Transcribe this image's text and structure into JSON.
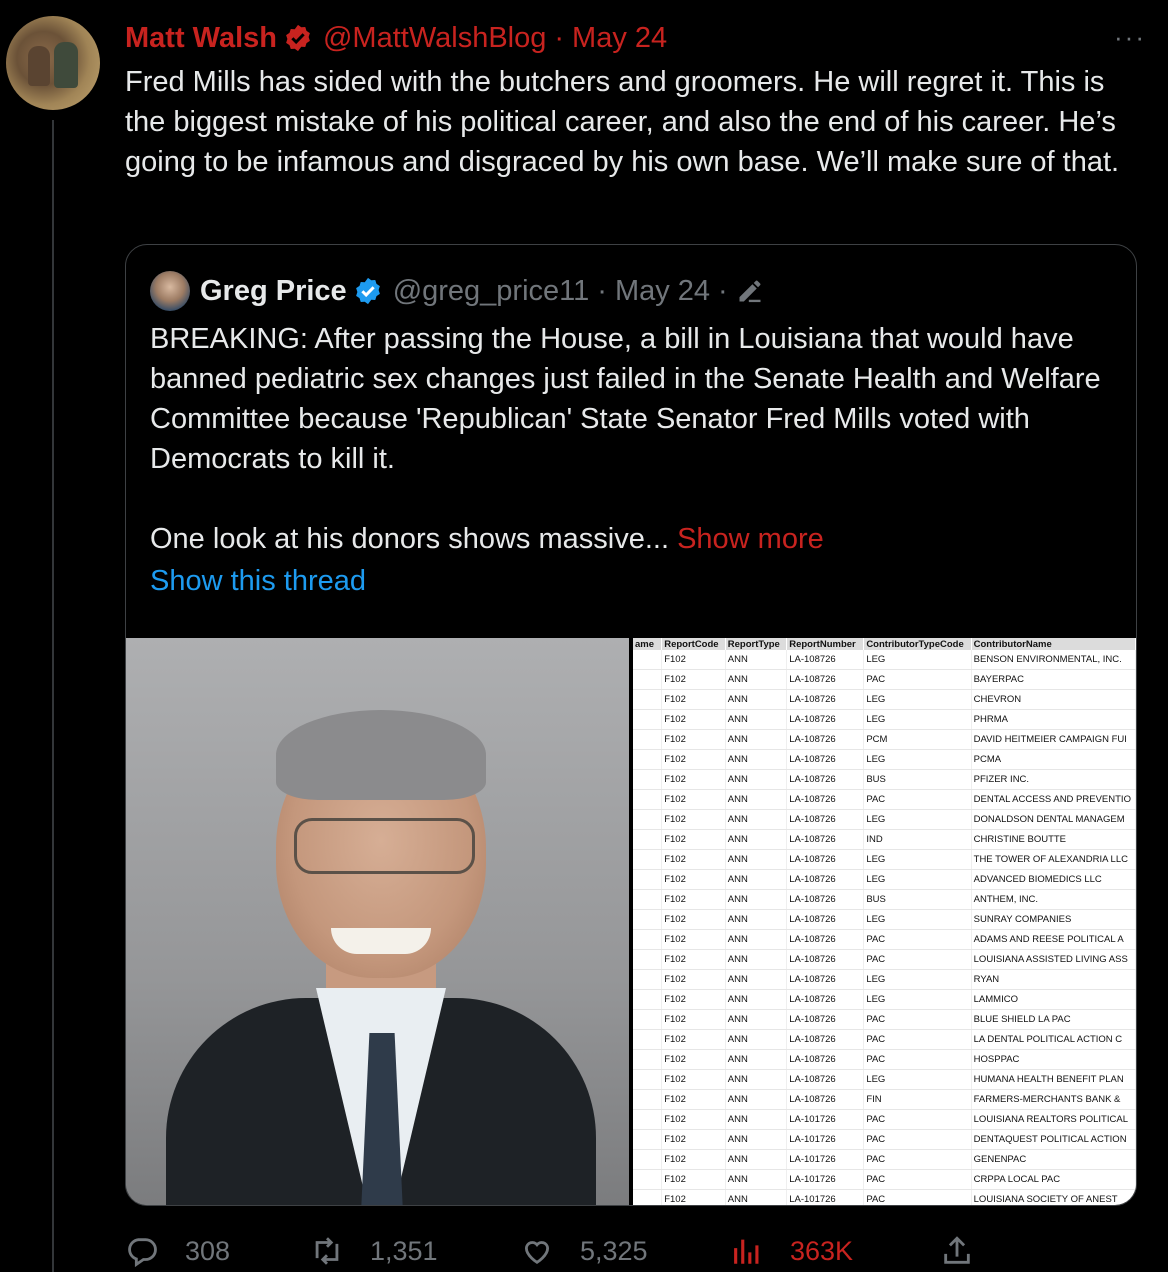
{
  "tweet": {
    "author_name": "Matt Walsh",
    "author_handle": "@MattWalshBlog",
    "date": "May 24",
    "text": "Fred Mills has sided with the butchers and groomers. He will regret it. This is the biggest mistake of his political career, and also the end of his career. He’s going to be infamous and disgraced by his own base. We’ll make sure of that.",
    "more_label": "···"
  },
  "quote": {
    "author_name": "Greg Price",
    "author_handle": "@greg_price11",
    "date": "May 24",
    "text_main": "BREAKING: After passing the House, a bill in Louisiana that would have banned pediatric sex changes just failed in the Senate Health and Welfare Committee because 'Republican' State Senator Fred Mills voted with Democrats to kill it.\n\nOne look at his donors shows massive... ",
    "show_more": "Show more",
    "show_thread": "Show this thread"
  },
  "sheet": {
    "headers": [
      "ame",
      "ReportCode",
      "ReportType",
      "ReportNumber",
      "ContributorTypeCode",
      "ContributorName"
    ],
    "rows": [
      [
        "",
        "F102",
        "ANN",
        "LA-108726",
        "LEG",
        "BENSON ENVIRONMENTAL, INC."
      ],
      [
        "",
        "F102",
        "ANN",
        "LA-108726",
        "PAC",
        "BAYERPAC"
      ],
      [
        "",
        "F102",
        "ANN",
        "LA-108726",
        "LEG",
        "CHEVRON"
      ],
      [
        "",
        "F102",
        "ANN",
        "LA-108726",
        "LEG",
        "PHRMA"
      ],
      [
        "",
        "F102",
        "ANN",
        "LA-108726",
        "PCM",
        "DAVID HEITMEIER CAMPAIGN FUI"
      ],
      [
        "",
        "F102",
        "ANN",
        "LA-108726",
        "LEG",
        "PCMA"
      ],
      [
        "",
        "F102",
        "ANN",
        "LA-108726",
        "BUS",
        "PFIZER INC."
      ],
      [
        "",
        "F102",
        "ANN",
        "LA-108726",
        "PAC",
        "DENTAL ACCESS AND PREVENTIO"
      ],
      [
        "",
        "F102",
        "ANN",
        "LA-108726",
        "LEG",
        "DONALDSON DENTAL MANAGEM"
      ],
      [
        "",
        "F102",
        "ANN",
        "LA-108726",
        "IND",
        "CHRISTINE BOUTTE"
      ],
      [
        "",
        "F102",
        "ANN",
        "LA-108726",
        "LEG",
        "THE TOWER OF ALEXANDRIA LLC"
      ],
      [
        "",
        "F102",
        "ANN",
        "LA-108726",
        "LEG",
        "ADVANCED BIOMEDICS LLC"
      ],
      [
        "",
        "F102",
        "ANN",
        "LA-108726",
        "BUS",
        "ANTHEM, INC."
      ],
      [
        "",
        "F102",
        "ANN",
        "LA-108726",
        "LEG",
        "SUNRAY COMPANIES"
      ],
      [
        "",
        "F102",
        "ANN",
        "LA-108726",
        "PAC",
        "ADAMS AND REESE POLITICAL A"
      ],
      [
        "",
        "F102",
        "ANN",
        "LA-108726",
        "PAC",
        "LOUISIANA ASSISTED LIVING ASS"
      ],
      [
        "",
        "F102",
        "ANN",
        "LA-108726",
        "LEG",
        "RYAN"
      ],
      [
        "",
        "F102",
        "ANN",
        "LA-108726",
        "LEG",
        "LAMMICO"
      ],
      [
        "",
        "F102",
        "ANN",
        "LA-108726",
        "PAC",
        "BLUE SHIELD LA PAC"
      ],
      [
        "",
        "F102",
        "ANN",
        "LA-108726",
        "PAC",
        "LA DENTAL POLITICAL ACTION C"
      ],
      [
        "",
        "F102",
        "ANN",
        "LA-108726",
        "PAC",
        "HOSPPAC"
      ],
      [
        "",
        "F102",
        "ANN",
        "LA-108726",
        "LEG",
        "HUMANA HEALTH BENEFIT PLAN"
      ],
      [
        "",
        "F102",
        "ANN",
        "LA-108726",
        "FIN",
        "FARMERS-MERCHANTS BANK &"
      ],
      [
        "",
        "F102",
        "ANN",
        "LA-101726",
        "PAC",
        "LOUISIANA REALTORS POLITICAL"
      ],
      [
        "",
        "F102",
        "ANN",
        "LA-101726",
        "PAC",
        "DENTAQUEST POLITICAL ACTION"
      ],
      [
        "",
        "F102",
        "ANN",
        "LA-101726",
        "PAC",
        "GENENPAC"
      ],
      [
        "",
        "F102",
        "ANN",
        "LA-101726",
        "PAC",
        "CRPPA LOCAL PAC"
      ],
      [
        "",
        "F102",
        "ANN",
        "LA-101726",
        "PAC",
        "LOUISIANA SOCIETY OF ANEST"
      ]
    ]
  },
  "actions": {
    "replies": "308",
    "retweets": "1,351",
    "likes": "5,325",
    "views": "363K"
  },
  "colors": {
    "accent_red": "#c8231f",
    "link_blue": "#1d9bf0",
    "muted": "#71767b",
    "text": "#e7e9ea",
    "background": "#000000"
  },
  "icons": [
    "verified-badge-icon",
    "more-icon",
    "edit-pencil-icon",
    "reply-icon",
    "retweet-icon",
    "like-icon",
    "views-icon",
    "share-icon"
  ]
}
